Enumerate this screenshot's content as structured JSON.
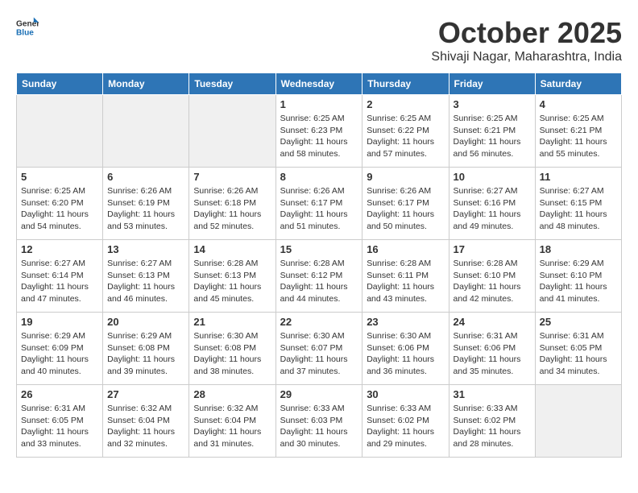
{
  "header": {
    "logo_general": "General",
    "logo_blue": "Blue",
    "month": "October 2025",
    "location": "Shivaji Nagar, Maharashtra, India"
  },
  "weekdays": [
    "Sunday",
    "Monday",
    "Tuesday",
    "Wednesday",
    "Thursday",
    "Friday",
    "Saturday"
  ],
  "weeks": [
    [
      {
        "day": "",
        "empty": true
      },
      {
        "day": "",
        "empty": true
      },
      {
        "day": "",
        "empty": true
      },
      {
        "day": "1",
        "sunrise": "6:25 AM",
        "sunset": "6:23 PM",
        "daylight": "11 hours and 58 minutes."
      },
      {
        "day": "2",
        "sunrise": "6:25 AM",
        "sunset": "6:22 PM",
        "daylight": "11 hours and 57 minutes."
      },
      {
        "day": "3",
        "sunrise": "6:25 AM",
        "sunset": "6:21 PM",
        "daylight": "11 hours and 56 minutes."
      },
      {
        "day": "4",
        "sunrise": "6:25 AM",
        "sunset": "6:21 PM",
        "daylight": "11 hours and 55 minutes."
      }
    ],
    [
      {
        "day": "5",
        "sunrise": "6:25 AM",
        "sunset": "6:20 PM",
        "daylight": "11 hours and 54 minutes."
      },
      {
        "day": "6",
        "sunrise": "6:26 AM",
        "sunset": "6:19 PM",
        "daylight": "11 hours and 53 minutes."
      },
      {
        "day": "7",
        "sunrise": "6:26 AM",
        "sunset": "6:18 PM",
        "daylight": "11 hours and 52 minutes."
      },
      {
        "day": "8",
        "sunrise": "6:26 AM",
        "sunset": "6:17 PM",
        "daylight": "11 hours and 51 minutes."
      },
      {
        "day": "9",
        "sunrise": "6:26 AM",
        "sunset": "6:17 PM",
        "daylight": "11 hours and 50 minutes."
      },
      {
        "day": "10",
        "sunrise": "6:27 AM",
        "sunset": "6:16 PM",
        "daylight": "11 hours and 49 minutes."
      },
      {
        "day": "11",
        "sunrise": "6:27 AM",
        "sunset": "6:15 PM",
        "daylight": "11 hours and 48 minutes."
      }
    ],
    [
      {
        "day": "12",
        "sunrise": "6:27 AM",
        "sunset": "6:14 PM",
        "daylight": "11 hours and 47 minutes."
      },
      {
        "day": "13",
        "sunrise": "6:27 AM",
        "sunset": "6:13 PM",
        "daylight": "11 hours and 46 minutes."
      },
      {
        "day": "14",
        "sunrise": "6:28 AM",
        "sunset": "6:13 PM",
        "daylight": "11 hours and 45 minutes."
      },
      {
        "day": "15",
        "sunrise": "6:28 AM",
        "sunset": "6:12 PM",
        "daylight": "11 hours and 44 minutes."
      },
      {
        "day": "16",
        "sunrise": "6:28 AM",
        "sunset": "6:11 PM",
        "daylight": "11 hours and 43 minutes."
      },
      {
        "day": "17",
        "sunrise": "6:28 AM",
        "sunset": "6:10 PM",
        "daylight": "11 hours and 42 minutes."
      },
      {
        "day": "18",
        "sunrise": "6:29 AM",
        "sunset": "6:10 PM",
        "daylight": "11 hours and 41 minutes."
      }
    ],
    [
      {
        "day": "19",
        "sunrise": "6:29 AM",
        "sunset": "6:09 PM",
        "daylight": "11 hours and 40 minutes."
      },
      {
        "day": "20",
        "sunrise": "6:29 AM",
        "sunset": "6:08 PM",
        "daylight": "11 hours and 39 minutes."
      },
      {
        "day": "21",
        "sunrise": "6:30 AM",
        "sunset": "6:08 PM",
        "daylight": "11 hours and 38 minutes."
      },
      {
        "day": "22",
        "sunrise": "6:30 AM",
        "sunset": "6:07 PM",
        "daylight": "11 hours and 37 minutes."
      },
      {
        "day": "23",
        "sunrise": "6:30 AM",
        "sunset": "6:06 PM",
        "daylight": "11 hours and 36 minutes."
      },
      {
        "day": "24",
        "sunrise": "6:31 AM",
        "sunset": "6:06 PM",
        "daylight": "11 hours and 35 minutes."
      },
      {
        "day": "25",
        "sunrise": "6:31 AM",
        "sunset": "6:05 PM",
        "daylight": "11 hours and 34 minutes."
      }
    ],
    [
      {
        "day": "26",
        "sunrise": "6:31 AM",
        "sunset": "6:05 PM",
        "daylight": "11 hours and 33 minutes."
      },
      {
        "day": "27",
        "sunrise": "6:32 AM",
        "sunset": "6:04 PM",
        "daylight": "11 hours and 32 minutes."
      },
      {
        "day": "28",
        "sunrise": "6:32 AM",
        "sunset": "6:04 PM",
        "daylight": "11 hours and 31 minutes."
      },
      {
        "day": "29",
        "sunrise": "6:33 AM",
        "sunset": "6:03 PM",
        "daylight": "11 hours and 30 minutes."
      },
      {
        "day": "30",
        "sunrise": "6:33 AM",
        "sunset": "6:02 PM",
        "daylight": "11 hours and 29 minutes."
      },
      {
        "day": "31",
        "sunrise": "6:33 AM",
        "sunset": "6:02 PM",
        "daylight": "11 hours and 28 minutes."
      },
      {
        "day": "",
        "empty": true
      }
    ]
  ]
}
